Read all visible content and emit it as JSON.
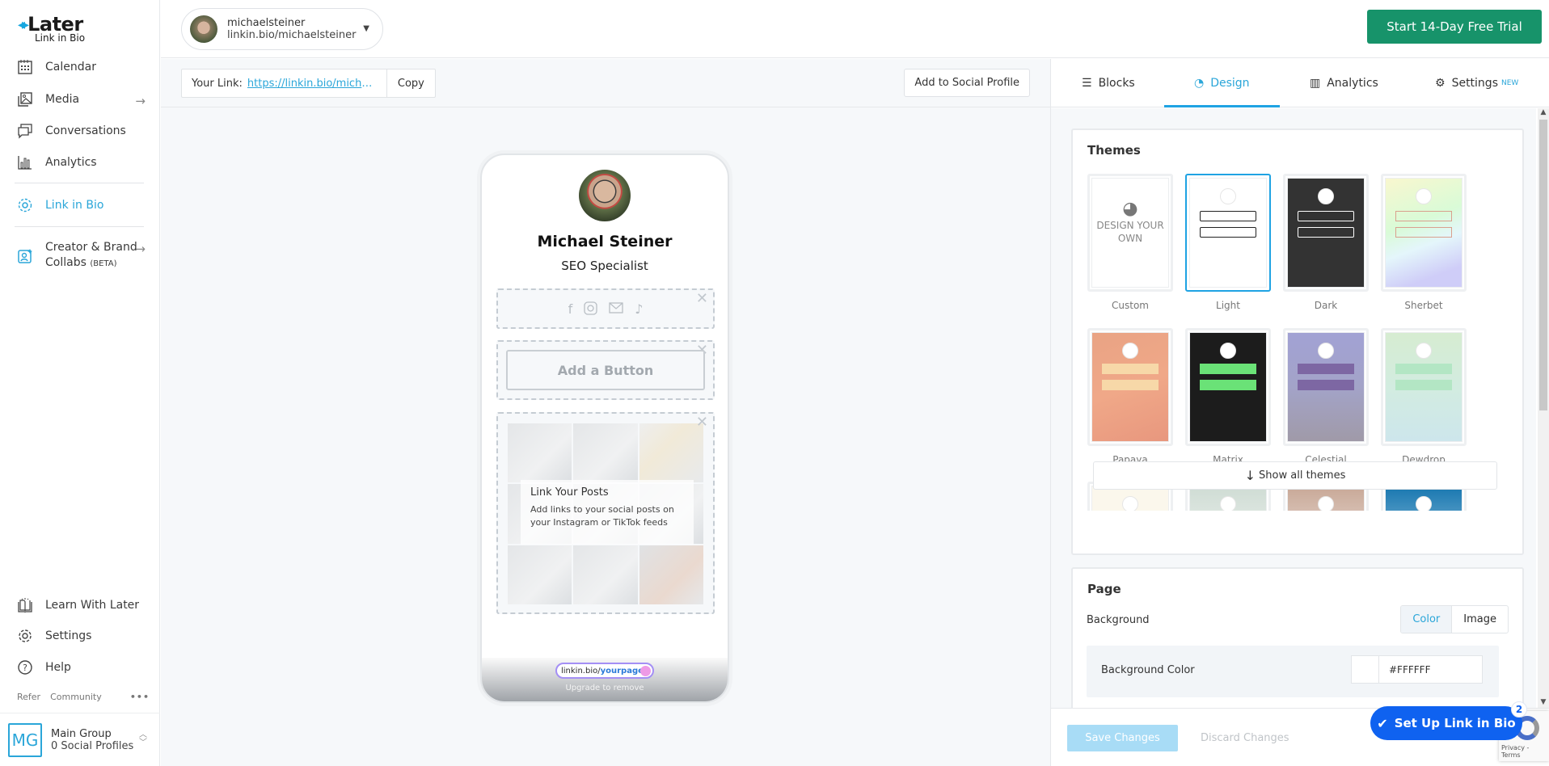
{
  "brand": {
    "name": "Later",
    "product": "Link in Bio",
    "accent": "#2aa6d9"
  },
  "sidebar": {
    "items": [
      {
        "label": "Calendar",
        "icon": "calendar-icon"
      },
      {
        "label": "Media",
        "icon": "image-icon",
        "arrow": "→"
      },
      {
        "label": "Conversations",
        "icon": "chat-icon"
      },
      {
        "label": "Analytics",
        "icon": "bar-chart-icon"
      },
      {
        "label": "Link in Bio",
        "icon": "link-in-bio-icon",
        "active": true
      },
      {
        "label": "Creator & Brand",
        "label2": "Collabs",
        "beta": "(BETA)",
        "icon": "creator-icon",
        "arrow": "→"
      }
    ],
    "bottom": [
      {
        "label": "Learn With Later",
        "icon": "book-icon"
      },
      {
        "label": "Settings",
        "icon": "gear-icon"
      },
      {
        "label": "Help",
        "icon": "help-icon"
      }
    ],
    "footer_links": [
      "Refer",
      "Community"
    ],
    "more": "•••",
    "group": {
      "initials": "MG",
      "name": "Main Group",
      "profiles": "0 Social Profiles"
    }
  },
  "topbar": {
    "profile": {
      "username": "michaelsteiner",
      "url": "linkin.bio/michaelsteiner"
    },
    "trial_button": "Start 14-Day Free Trial",
    "trial_color": "#17936a"
  },
  "center": {
    "your_link_label": "Your Link:",
    "your_link_url": "https://linkin.bio/michaelsteiner",
    "copy_label": "Copy",
    "add_social_label": "Add to Social Profile"
  },
  "preview": {
    "name": "Michael Steiner",
    "title": "SEO Specialist",
    "social_icons": [
      "facebook-icon",
      "instagram-icon",
      "email-icon",
      "tiktok-icon"
    ],
    "add_button_label": "Add a Button",
    "posts_title": "Link Your Posts",
    "posts_desc": "Add links to your social posts on your Instagram or TikTok feeds",
    "bio_pill_prefix": "linkin.bio/",
    "bio_pill_suffix": "yourpage",
    "upgrade_text": "Upgrade to remove"
  },
  "rpanel": {
    "tabs": [
      {
        "label": "Blocks",
        "icon": "blocks-icon"
      },
      {
        "label": "Design",
        "icon": "palette-icon",
        "active": true
      },
      {
        "label": "Analytics",
        "icon": "bar-chart-icon"
      },
      {
        "label": "Settings",
        "icon": "gear-icon",
        "badge": "NEW"
      }
    ],
    "themes_title": "Themes",
    "design_own": "DESIGN YOUR OWN",
    "themes": [
      {
        "name": "Custom"
      },
      {
        "name": "Light",
        "selected": true
      },
      {
        "name": "Dark"
      },
      {
        "name": "Sherbet"
      },
      {
        "name": "Papaya"
      },
      {
        "name": "Matrix"
      },
      {
        "name": "Celestial"
      },
      {
        "name": "Dewdrop"
      }
    ],
    "show_all": "Show all themes",
    "page_title": "Page",
    "background_label": "Background",
    "bg_options": [
      "Color",
      "Image"
    ],
    "bg_selected": "Color",
    "bg_color_label": "Background Color",
    "bg_color_value": "#FFFFFF",
    "save_label": "Save Changes",
    "discard_label": "Discard Changes"
  },
  "setup": {
    "label": "Set Up Link in Bio",
    "badge": "2"
  },
  "recaptcha": {
    "text": "Privacy - Terms"
  }
}
